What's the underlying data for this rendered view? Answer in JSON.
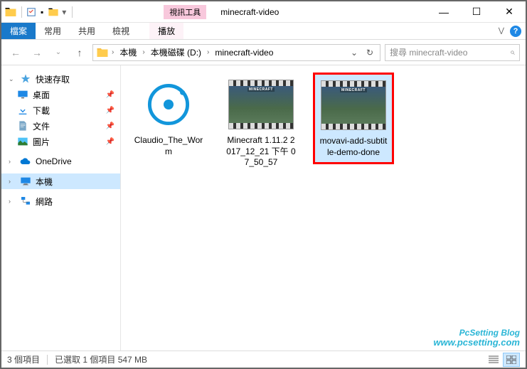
{
  "window": {
    "context_tab": "視訊工具",
    "title": "minecraft-video"
  },
  "ribbon": {
    "file": "檔案",
    "tabs": [
      "常用",
      "共用",
      "檢視"
    ],
    "play_tab": "播放"
  },
  "address": {
    "crumbs": [
      "本機",
      "本機磁碟 (D:)",
      "minecraft-video"
    ],
    "search_placeholder": "搜尋 minecraft-video"
  },
  "sidebar": {
    "quick_access": "快速存取",
    "desktop": "桌面",
    "downloads": "下載",
    "documents": "文件",
    "pictures": "圖片",
    "onedrive": "OneDrive",
    "this_pc": "本機",
    "network": "網路"
  },
  "files": [
    {
      "name": "Claudio_The_Worm",
      "type": "audio",
      "selected": false,
      "highlighted": false
    },
    {
      "name": "Minecraft 1.11.2 2017_12_21 下午 07_50_57",
      "type": "video",
      "selected": false,
      "highlighted": false
    },
    {
      "name": "movavi-add-subtitle-demo-done",
      "type": "video",
      "selected": true,
      "highlighted": true
    }
  ],
  "status": {
    "count": "3 個項目",
    "selection": "已選取 1 個項目 547 MB"
  },
  "watermark": {
    "line1": "PcSetting Blog",
    "line2": "www.pcsetting.com"
  }
}
